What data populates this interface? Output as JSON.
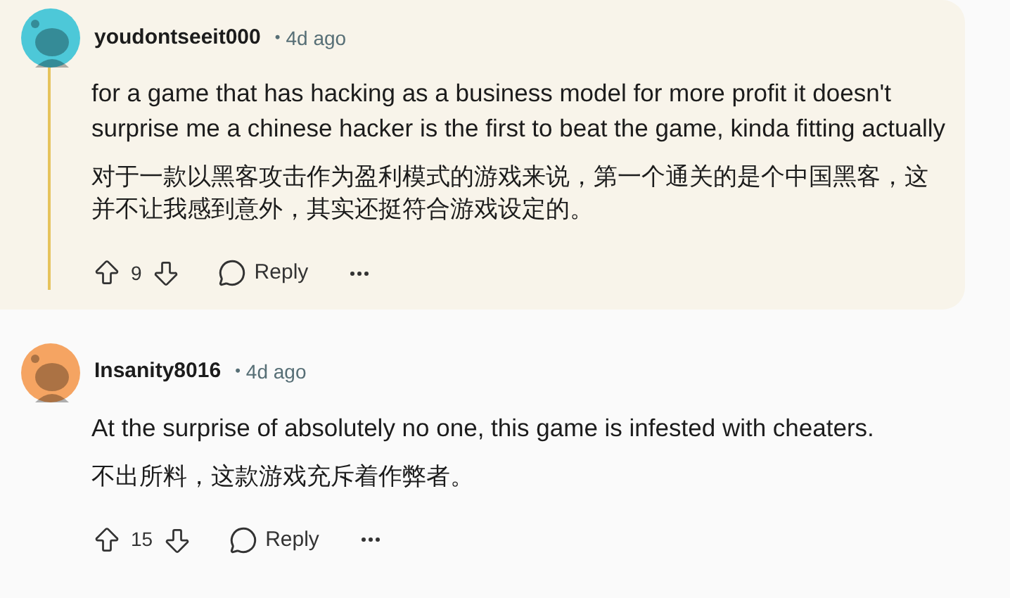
{
  "comments": [
    {
      "username": "youdontseeit000",
      "separator": "•",
      "time": "4d ago",
      "highlighted": true,
      "color": "#4dc8d8",
      "text": "for a game that has hacking as a business model for more profit it doesn't surprise me a chinese hacker is the first to beat the game, kinda fitting actually",
      "translation": "对于一款以黑客攻击作为盈利模式的游戏来说，第一个通关的是个中国黑客，这并不让我感到意外，其实还挺符合游戏设定的。",
      "votes": "9",
      "reply": "Reply"
    },
    {
      "username": "Insanity8016",
      "separator": "•",
      "time": "4d ago",
      "highlighted": false,
      "color": "#f5a462",
      "text": "At the surprise of absolutely no one, this game is infested with cheaters.",
      "translation": "不出所料，这款游戏充斥着作弊者。",
      "votes": "15",
      "reply": "Reply"
    }
  ]
}
